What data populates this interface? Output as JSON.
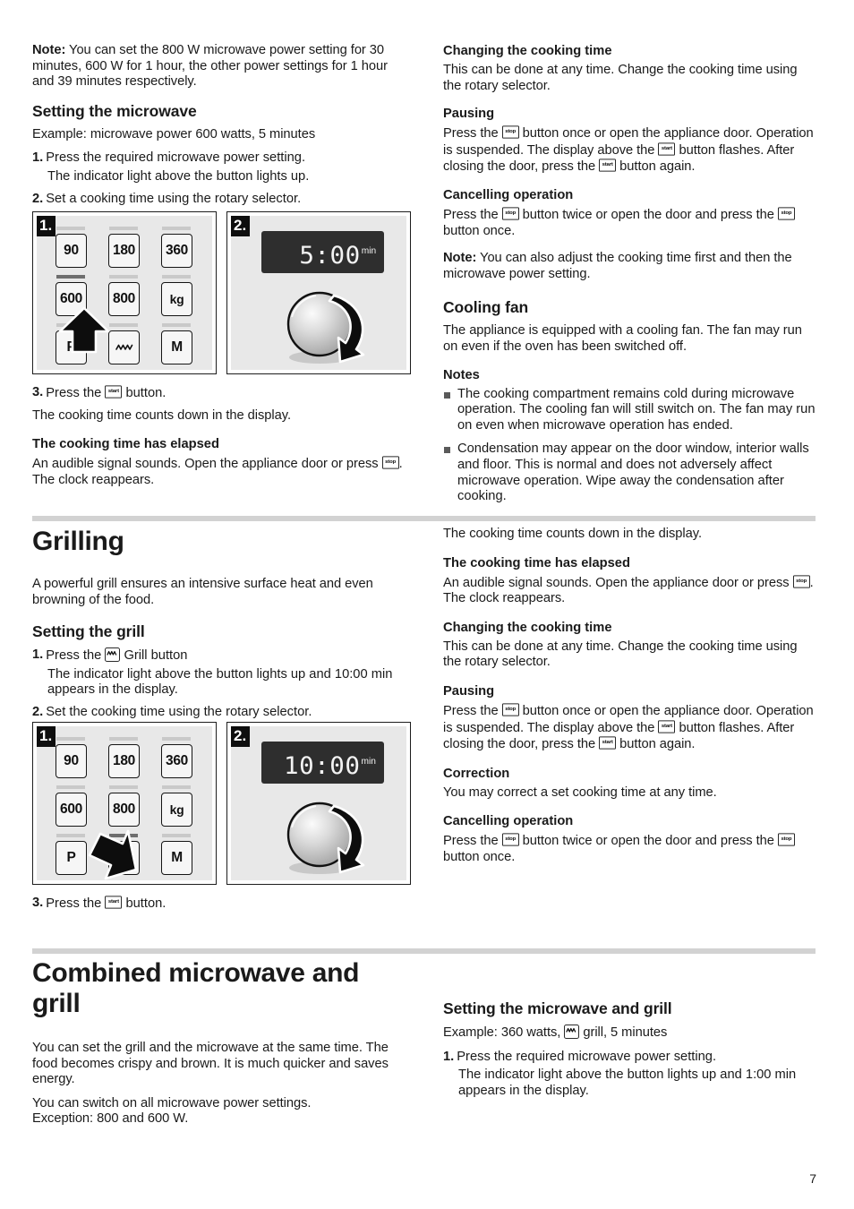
{
  "page": {
    "number": "7"
  },
  "left_column": {
    "note_intro": {
      "label": "Note:",
      "text": " You can set the 800 W microwave power setting for 30 minutes, 600 W for 1 hour, the other power settings for 1 hour and 39 minutes respectively."
    },
    "setting_microwave": {
      "heading": "Setting the microwave",
      "example": "Example: microwave power 600 watts, 5 minutes",
      "step1_num": "1.",
      "step1_text": "Press the required microwave power setting.",
      "step1_sub": "The indicator light above the button lights up.",
      "step2_num": "2.",
      "step2_text": "Set a cooking time using the rotary selector.",
      "step3_num": "3.",
      "step3_pre": "Press the ",
      "step3_post": " button.",
      "step3_button": "start",
      "after_step3": "The cooking time counts down in the display."
    },
    "elapsed": {
      "heading": "The cooking time has elapsed",
      "text_pre": "An audible signal sounds. Open the appliance door or press ",
      "button": "stop",
      "text_post": ". The clock reappears."
    }
  },
  "right_column": {
    "changing_time": {
      "heading": "Changing the cooking time",
      "text": "This can be done at any time. Change the cooking time using the rotary selector."
    },
    "pausing": {
      "heading": "Pausing",
      "part1": "Press the ",
      "button_stop": "stop",
      "part2": " button once or open the appliance door. Operation is suspended. The display above the ",
      "button_start1": "start",
      "part3": " button flashes. After closing the door, press the ",
      "button_start2": "start",
      "part4": " button again."
    },
    "cancelling": {
      "heading": "Cancelling operation",
      "part1": "Press the ",
      "button_stop1": "stop",
      "part2": " button twice or open the door and press the ",
      "button_stop2": "stop",
      "part3": " button once."
    },
    "note": {
      "label": "Note:",
      "text": " You can also adjust the cooking time first and then the microwave power setting."
    },
    "cooling_fan": {
      "heading": "Cooling fan",
      "text": "The appliance is equipped with a cooling fan. The fan may run on even if the oven has been switched off.",
      "notes_heading": "Notes",
      "note1": "The cooking compartment remains cold during microwave operation. The cooling fan will still switch on. The fan may run on even when microwave operation has ended.",
      "note2": "Condensation may appear on the door window, interior walls and floor. This is normal and does not adversely affect microwave operation. Wipe away the condensation after cooking."
    }
  },
  "grilling": {
    "title": "Grilling",
    "intro": "A powerful grill ensures an intensive surface heat and even browning of the food.",
    "setting_grill": {
      "heading": "Setting the grill",
      "step1_num": "1.",
      "step1_pre": "Press the ",
      "step1_post": " Grill button",
      "step1_sub": "The indicator light above the button lights up and 10:00 min appears in the display.",
      "step2_num": "2.",
      "step2_text": "Set the cooking time using the rotary selector.",
      "step3_num": "3.",
      "step3_pre": "Press the ",
      "step3_post": " button.",
      "step3_button": "start"
    },
    "right": {
      "counts_down": "The cooking time counts down in the display.",
      "elapsed_heading": "The cooking time has elapsed",
      "elapsed_pre": "An audible signal sounds. Open the appliance door or press ",
      "elapsed_button": "stop",
      "elapsed_post": ". The clock reappears.",
      "changing_heading": "Changing the cooking time",
      "changing_text": "This can be done at any time. Change the cooking time using the rotary selector.",
      "pausing_heading": "Pausing",
      "pausing_part1": "Press the ",
      "pausing_stop": "stop",
      "pausing_part2": " button once or open the appliance door. Operation is suspended. The display above the ",
      "pausing_start1": "start",
      "pausing_part3": " button flashes. After closing the door, press the ",
      "pausing_start2": "start",
      "pausing_part4": " button again.",
      "correction_heading": "Correction",
      "correction_text": "You may correct a set cooking time at any time.",
      "cancelling_heading": "Cancelling operation",
      "cancelling_part1": "Press the ",
      "cancelling_stop1": "stop",
      "cancelling_part2": " button twice or open the door and press the ",
      "cancelling_stop2": "stop",
      "cancelling_part3": " button once."
    }
  },
  "combined": {
    "title": "Combined microwave and grill",
    "intro1": "You can set the grill and the microwave at the same time. The food becomes crispy and brown. It is much quicker and saves energy.",
    "intro2a": "You can switch on all microwave power settings.",
    "intro2b": "Exception: 800 and 600 W.",
    "right": {
      "heading": "Setting the microwave and grill",
      "example_pre": "Example: 360 watts, ",
      "example_post": " grill, 5 minutes",
      "step1_num": "1.",
      "step1_text": "Press the required microwave power setting.",
      "step1_sub": "The indicator light above the button lights up and 1:00 min appears in the display."
    }
  },
  "figures": {
    "microwave": {
      "panel1_badge": "1.",
      "panel2_badge": "2.",
      "keys": [
        {
          "label": "90",
          "icon": "",
          "active": false
        },
        {
          "label": "180",
          "icon": "",
          "active": false
        },
        {
          "label": "360",
          "icon": "",
          "active": false
        },
        {
          "label": "600",
          "icon": "",
          "active": true
        },
        {
          "label": "800",
          "icon": "",
          "active": false
        },
        {
          "label": "kg",
          "icon": "",
          "active": false
        },
        {
          "label": "P",
          "icon": "",
          "active": false
        },
        {
          "label": "",
          "icon": "grill-wave-icon",
          "active": false
        },
        {
          "label": "M",
          "icon": "",
          "active": false
        }
      ],
      "display_time": "5:00",
      "display_unit": "min"
    },
    "grill": {
      "panel1_badge": "1.",
      "panel2_badge": "2.",
      "keys": [
        {
          "label": "90",
          "icon": "",
          "active": false
        },
        {
          "label": "180",
          "icon": "",
          "active": false
        },
        {
          "label": "360",
          "icon": "",
          "active": false
        },
        {
          "label": "600",
          "icon": "",
          "active": false
        },
        {
          "label": "800",
          "icon": "",
          "active": false
        },
        {
          "label": "kg",
          "icon": "",
          "active": false
        },
        {
          "label": "P",
          "icon": "",
          "active": false
        },
        {
          "label": "",
          "icon": "grill-wave-icon",
          "active": true
        },
        {
          "label": "M",
          "icon": "",
          "active": false
        }
      ],
      "display_time": "10:00",
      "display_unit": "min"
    }
  },
  "colors": {
    "rule": "#d2d2d2",
    "panel_bg": "#e8e8e8",
    "lcd_bg": "#2e2e2e",
    "indicator_on": "#6e6e6e",
    "indicator_off": "#c9c9c9"
  }
}
